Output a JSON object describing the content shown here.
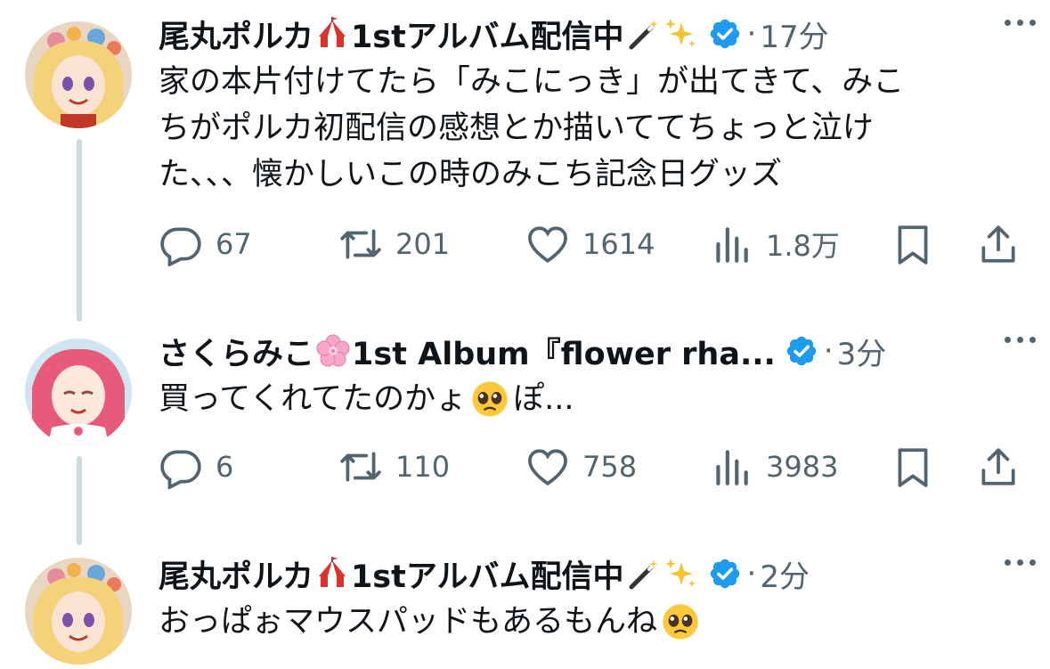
{
  "tweets": [
    {
      "user": {
        "name": "尾丸ポルカ",
        "name_suffix": "1stアルバム配信中",
        "emojis": [
          "circus-tent-emoji",
          "magic-wand-emoji",
          "sparkles-emoji"
        ],
        "verified": true
      },
      "time": "17分",
      "text_lines": [
        "家の本片付けてたら「みこにっき」が出てきて、みこ",
        "ちがポルカ初配信の感想とか描いててちょっと泣け",
        "た、、、懐かしいこの時のみこち記念日グッズ"
      ],
      "stats": {
        "replies": "67",
        "retweets": "201",
        "likes": "1614",
        "views": "1.8万"
      }
    },
    {
      "user": {
        "name": "さくらみこ",
        "name_suffix": "1st Album『flower rha...",
        "emojis": [
          "cherry-blossom-emoji"
        ],
        "verified": true
      },
      "time": "3分",
      "text_lines": [
        "買ってくれてたのかょ",
        "ぽ..."
      ],
      "text_emoji": "pleading-face-emoji",
      "stats": {
        "replies": "6",
        "retweets": "110",
        "likes": "758",
        "views": "3983"
      }
    },
    {
      "user": {
        "name": "尾丸ポルカ",
        "name_suffix": "1stアルバム配信中",
        "emojis": [
          "circus-tent-emoji",
          "magic-wand-emoji",
          "sparkles-emoji"
        ],
        "verified": true
      },
      "time": "2分",
      "text_lines": [
        "おっぱぉマウスパッドもあるもんね"
      ],
      "text_emoji": "pleading-face-emoji"
    }
  ],
  "separator": "·",
  "colors": {
    "verified": "#1d9bf0",
    "muted": "#536471",
    "thread_line": "#cfd9de",
    "text": "#0f1419"
  }
}
